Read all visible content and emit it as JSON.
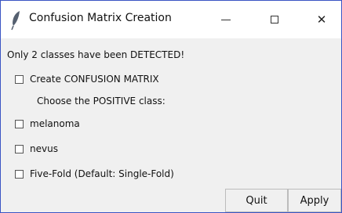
{
  "window": {
    "title": "Confusion Matrix Creation",
    "icon": "feather-icon",
    "controls": {
      "minimize": "minimize-icon",
      "maximize": "maximize-icon",
      "close": "close-icon",
      "close_glyph": "✕"
    }
  },
  "message": "Only 2 classes have been DETECTED!",
  "options": {
    "confusion_matrix": {
      "label": "Create CONFUSION MATRIX",
      "checked": false
    },
    "positive_class_prompt": "Choose the POSITIVE class:",
    "classes": [
      {
        "label": "melanoma",
        "checked": false
      },
      {
        "label": "nevus",
        "checked": false
      }
    ],
    "five_fold": {
      "label": "Five-Fold (Default: Single-Fold)",
      "checked": false
    }
  },
  "buttons": {
    "quit": "Quit",
    "apply": "Apply"
  },
  "colors": {
    "window_border": "#3a55c4",
    "background": "#f0f0f0",
    "titlebar": "#ffffff"
  }
}
